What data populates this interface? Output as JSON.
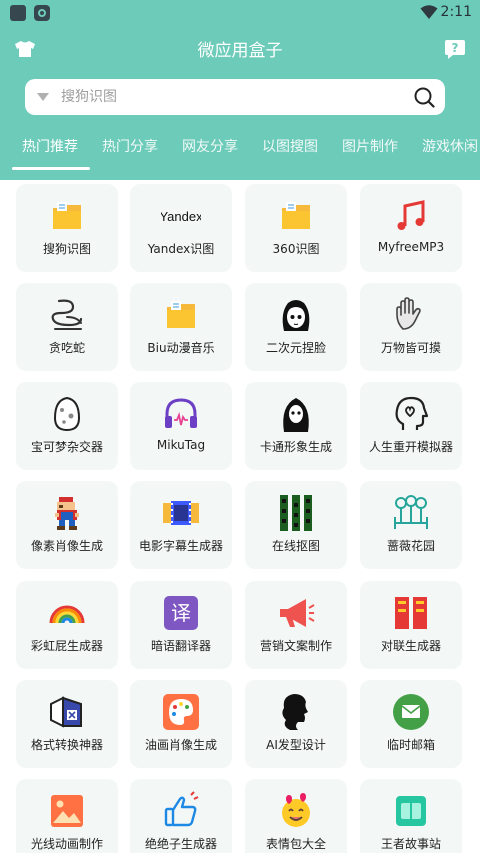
{
  "status": {
    "time": "2:11"
  },
  "header": {
    "title": "微应用盒子"
  },
  "search": {
    "placeholder": "搜狗识图"
  },
  "tabs": [
    "热门推荐",
    "热门分享",
    "网友分享",
    "以图搜图",
    "图片制作",
    "游戏休闲"
  ],
  "apps": [
    {
      "label": "搜狗识图",
      "icon": "folder-icon"
    },
    {
      "label": "Yandex识图",
      "icon": "yandex-logo-icon",
      "logo_text": "Yandex"
    },
    {
      "label": "360识图",
      "icon": "folder-icon"
    },
    {
      "label": "MyfreeMP3",
      "icon": "music-note-icon"
    },
    {
      "label": "贪吃蛇",
      "icon": "snake-icon"
    },
    {
      "label": "Biu动漫音乐",
      "icon": "folder-icon"
    },
    {
      "label": "二次元捏脸",
      "icon": "anime-face-icon"
    },
    {
      "label": "万物皆可摸",
      "icon": "hand-icon"
    },
    {
      "label": "宝可梦杂交器",
      "icon": "egg-icon"
    },
    {
      "label": "MikuTag",
      "icon": "headphones-icon"
    },
    {
      "label": "卡通形象生成",
      "icon": "ghost-icon"
    },
    {
      "label": "人生重开模拟器",
      "icon": "head-heart-icon"
    },
    {
      "label": "像素肖像生成",
      "icon": "pixel-mario-icon"
    },
    {
      "label": "电影字幕生成器",
      "icon": "film-strip-icon"
    },
    {
      "label": "在线抠图",
      "icon": "cutout-icon"
    },
    {
      "label": "蔷薇花园",
      "icon": "garden-icon"
    },
    {
      "label": "彩虹屁生成器",
      "icon": "rainbow-icon"
    },
    {
      "label": "暗语翻译器",
      "icon": "translate-icon",
      "logo_text": "译"
    },
    {
      "label": "营销文案制作",
      "icon": "megaphone-icon"
    },
    {
      "label": "对联生成器",
      "icon": "couplet-icon"
    },
    {
      "label": "格式转换神器",
      "icon": "cube-convert-icon"
    },
    {
      "label": "油画肖像生成",
      "icon": "palette-icon"
    },
    {
      "label": "AI发型设计",
      "icon": "hair-silhouette-icon"
    },
    {
      "label": "临时邮箱",
      "icon": "mail-icon"
    },
    {
      "label": "光线动画制作",
      "icon": "image-icon"
    },
    {
      "label": "绝绝子生成器",
      "icon": "thumbs-up-icon"
    },
    {
      "label": "表情包大全",
      "icon": "emoji-icon"
    },
    {
      "label": "王者故事站",
      "icon": "book-icon"
    }
  ]
}
